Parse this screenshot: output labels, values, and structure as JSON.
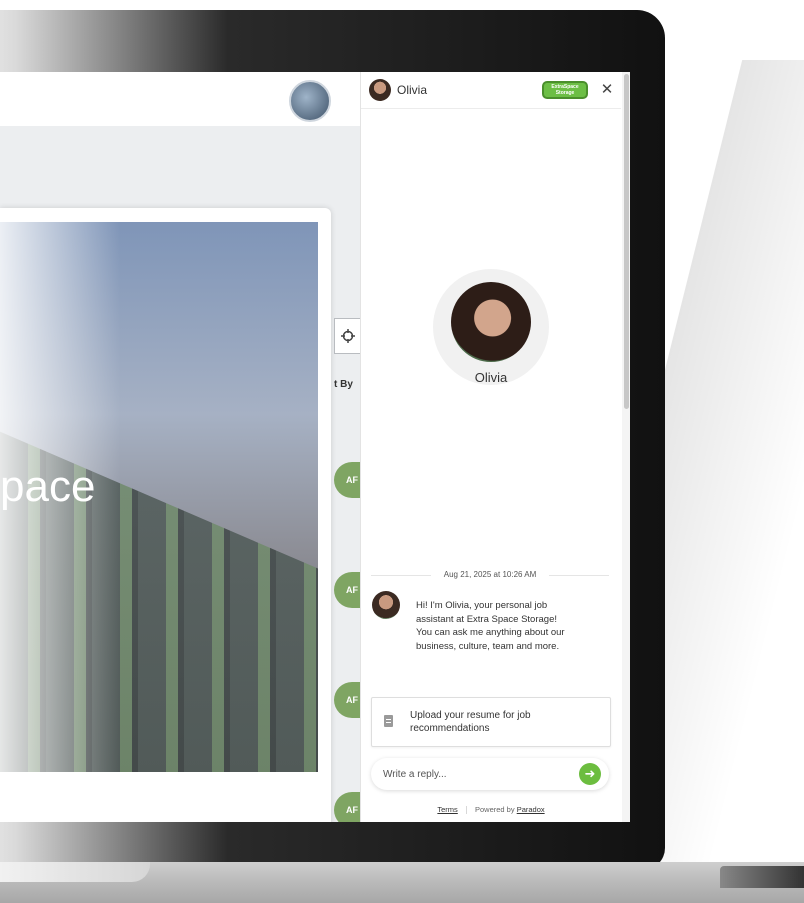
{
  "site": {
    "hero_text": "pace",
    "column_header": "t By",
    "row_badges": [
      "AF",
      "AF",
      "AF",
      "AF"
    ]
  },
  "chat": {
    "header": {
      "name": "Olivia",
      "logo_line1": "ExtraSpace",
      "logo_line2": "Storage",
      "close": "✕"
    },
    "profile_name": "Olivia",
    "timestamp": "Aug 21, 2025 at 10:26 AM",
    "message": "Hi! I'm Olivia, your personal job assistant at Extra Space Storage! You can ask me anything about our business, culture, team and more.",
    "upload_label": "Upload your resume for job recommendations",
    "reply_placeholder": "Write a reply...",
    "send_icon": "➜",
    "footer": {
      "terms": "Terms",
      "powered_by": "Powered by",
      "brand": "Paradox"
    }
  },
  "colors": {
    "accent": "#6cbd3f",
    "badge": "#7fa563"
  }
}
